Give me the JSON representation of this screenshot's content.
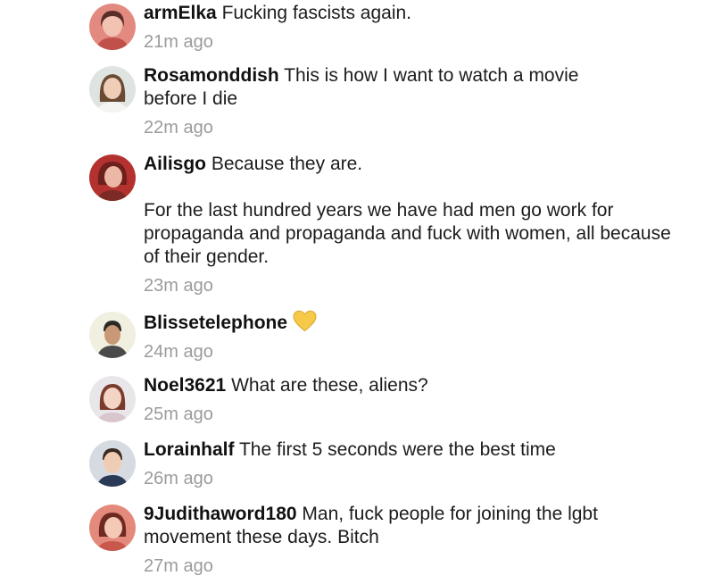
{
  "comments": [
    {
      "username": "armElka",
      "message": "Fucking fascists again.",
      "time": "21m ago"
    },
    {
      "username": "Rosamonddish",
      "message": "This is how I want to watch a movie\nbefore I die",
      "time": "22m ago"
    },
    {
      "username": "Ailisgo",
      "message": "Because they are.\n\nFor the last hundred years we have had men go work for propaganda and propaganda and fuck with women, all because of their gender.",
      "time": "23m ago"
    },
    {
      "username": "Blissetelephone",
      "message": "",
      "emoji": "yellow-heart",
      "time": "24m ago"
    },
    {
      "username": "Noel3621",
      "message": "What are these, aliens?",
      "time": "25m ago"
    },
    {
      "username": "Lorainhalf",
      "message": "The first 5 seconds were the best time",
      "time": "26m ago"
    },
    {
      "username": "9Judithaword180",
      "message": "Man, fuck people for joining the lgbt movement these days. Bitch",
      "time": "27m ago"
    }
  ],
  "colors": {
    "username": "#111111",
    "message": "#1c1c1c",
    "timestamp": "#9b9b9b",
    "heart": "#f7c948"
  }
}
